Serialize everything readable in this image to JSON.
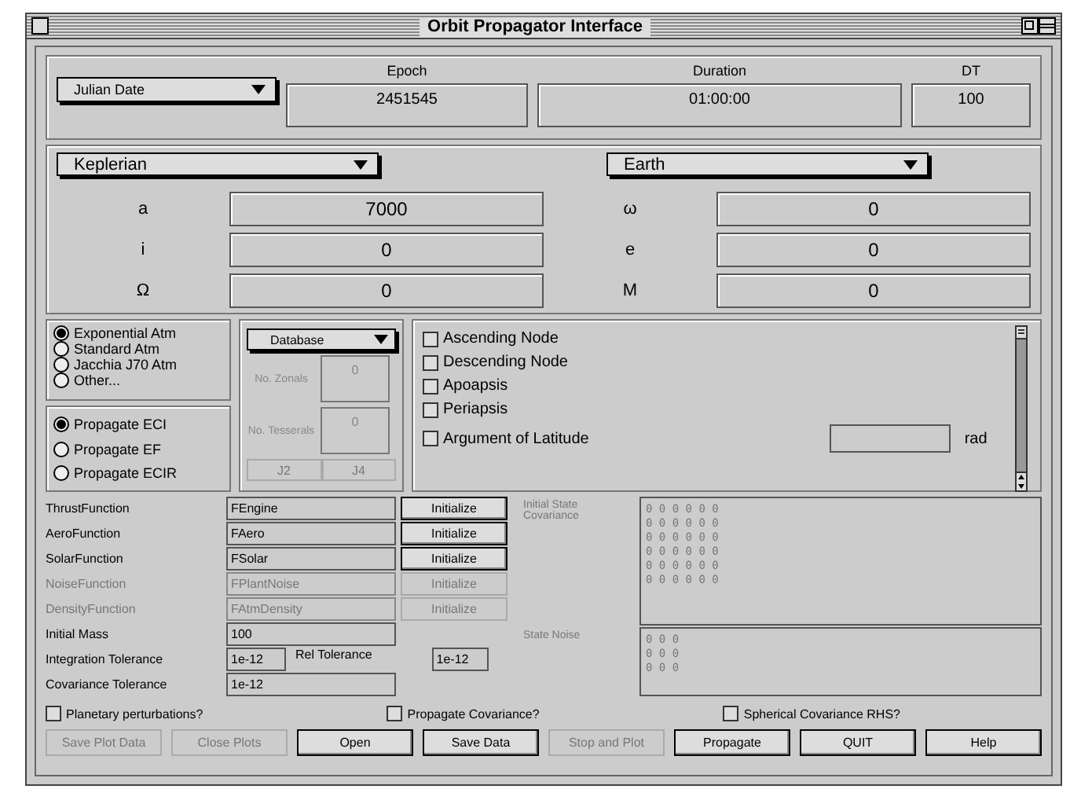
{
  "window": {
    "title": "Orbit Propagator Interface"
  },
  "time": {
    "format": "Julian Date",
    "epoch_label": "Epoch",
    "epoch": "2451545",
    "duration_label": "Duration",
    "duration": "01:00:00",
    "dt_label": "DT",
    "dt": "100"
  },
  "elements": {
    "set": "Keplerian",
    "body": "Earth",
    "fields": [
      {
        "label": "a",
        "value": "7000"
      },
      {
        "label": "ω",
        "value": "0"
      },
      {
        "label": "i",
        "value": "0"
      },
      {
        "label": "e",
        "value": "0"
      },
      {
        "label": "Ω",
        "value": "0"
      },
      {
        "label": "M",
        "value": "0"
      }
    ]
  },
  "atmosphere": [
    {
      "label": "Exponential Atm",
      "selected": true
    },
    {
      "label": "Standard Atm",
      "selected": false
    },
    {
      "label": "Jacchia J70 Atm",
      "selected": false
    },
    {
      "label": "Other...",
      "selected": false
    }
  ],
  "frames": [
    {
      "label": "Propagate ECI",
      "selected": true
    },
    {
      "label": "Propagate EF",
      "selected": false
    },
    {
      "label": "Propagate ECIR",
      "selected": false
    }
  ],
  "gravity": {
    "source": "Database",
    "disabled": true,
    "zonals_label": "No. Zonals",
    "zonals": "0",
    "tesserals_label": "No. Tesserals",
    "tesserals": "0",
    "buttons": [
      "J2",
      "J4"
    ]
  },
  "events": [
    {
      "label": "Ascending Node",
      "checked": false
    },
    {
      "label": "Descending Node",
      "checked": false
    },
    {
      "label": "Apoapsis",
      "checked": false
    },
    {
      "label": "Periapsis",
      "checked": false
    },
    {
      "label": "Argument of Latitude",
      "checked": false
    }
  ],
  "angle_unit": "rad",
  "functions": [
    {
      "label": "ThrustFunction",
      "value": "FEngine",
      "button": "Initialize",
      "disabled": false
    },
    {
      "label": "AeroFunction",
      "value": "FAero",
      "button": "Initialize",
      "disabled": false
    },
    {
      "label": "SolarFunction",
      "value": "FSolar",
      "button": "Initialize",
      "disabled": false
    },
    {
      "label": "NoiseFunction",
      "value": "FPlantNoise",
      "button": "Initialize",
      "disabled": true
    },
    {
      "label": "DensityFunction",
      "value": "FAtmDensity",
      "button": "Initialize",
      "disabled": true
    }
  ],
  "initial_mass": {
    "label": "Initial Mass",
    "value": "100"
  },
  "integration_tolerance": {
    "label": "Integration Tolerance",
    "value": "1e-12"
  },
  "rel_tolerance": {
    "label": "Rel Tolerance",
    "value": "1e-12"
  },
  "covariance_tolerance": {
    "label": "Covariance Tolerance",
    "value": "1e-12"
  },
  "covariance": {
    "label": "Initial State Covariance",
    "rows": [
      "0 0 0 0 0 0",
      "0 0 0 0 0 0",
      "0 0 0 0 0 0",
      "0 0 0 0 0 0",
      "0 0 0 0 0 0",
      "0 0 0 0 0 0"
    ]
  },
  "state_noise": {
    "label": "State Noise",
    "rows": [
      "0 0 0",
      "0 0 0",
      "0 0 0"
    ]
  },
  "options": [
    {
      "label": "Planetary perturbations?",
      "checked": false
    },
    {
      "label": "Propagate Covariance?",
      "checked": false
    },
    {
      "label": "Spherical Covariance RHS?",
      "checked": false
    }
  ],
  "buttons": [
    {
      "label": "Save Plot Data",
      "disabled": true
    },
    {
      "label": "Close Plots",
      "disabled": true
    },
    {
      "label": "Open",
      "disabled": false
    },
    {
      "label": "Save Data",
      "disabled": false
    },
    {
      "label": "Stop and Plot",
      "disabled": true
    },
    {
      "label": "Propagate",
      "disabled": false
    },
    {
      "label": "QUIT",
      "disabled": false
    },
    {
      "label": "Help",
      "disabled": false
    }
  ]
}
